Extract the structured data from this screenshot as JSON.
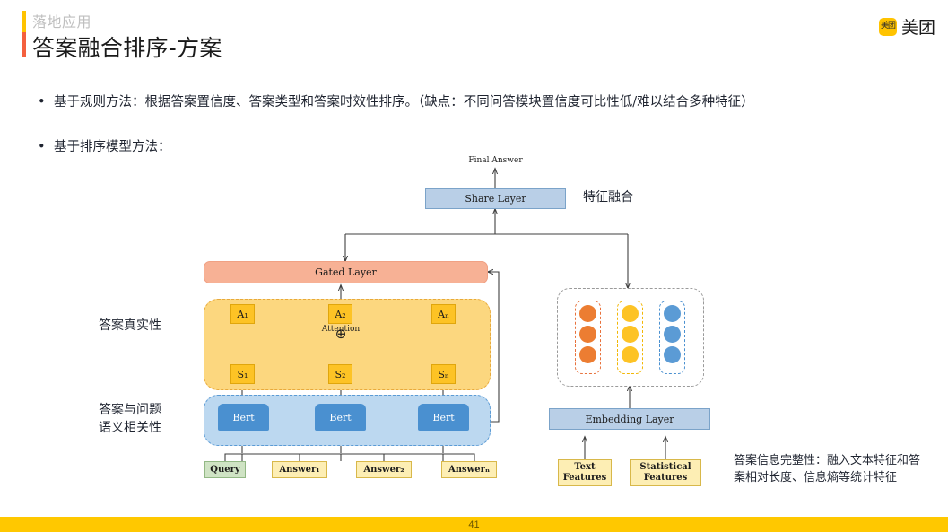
{
  "header": {
    "kicker": "落地应用",
    "title": "答案融合排序-方案",
    "accent_top": "#ffc300",
    "accent_bottom": "#f4603e"
  },
  "logo": {
    "mark_text": "美团",
    "text": "美团",
    "color": "#ffc300"
  },
  "bullets": [
    {
      "marker": "•",
      "text": "基于规则方法：根据答案置信度、答案类型和答案时效性排序。（缺点：不同问答模块置信度可比性低/难以结合多种特征）"
    },
    {
      "marker": "•",
      "text": "基于排序模型方法："
    }
  ],
  "diagram": {
    "final_answer": "Final Answer",
    "share_layer": "Share Layer",
    "fusion_note": "特征融合",
    "gated_layer": "Gated Layer",
    "attention_label": "Attention",
    "plus_symbol": "⊕",
    "attention_nodes": [
      "A₁",
      "A₂",
      "Aₙ"
    ],
    "score_nodes": [
      "S₁",
      "S₂",
      "Sₙ"
    ],
    "bert_nodes": [
      "Bert",
      "Bert",
      "Bert"
    ],
    "inputs": [
      {
        "label": "Query",
        "type": "query"
      },
      {
        "label": "Answer₁",
        "type": "answer"
      },
      {
        "label": "Answer₂",
        "type": "answer"
      },
      {
        "label": "Answerₙ",
        "type": "answer"
      }
    ],
    "embedding_layer": "Embedding Layer",
    "feature_inputs": [
      "Text\nFeatures",
      "Statistical\nFeatures"
    ],
    "feature_inputs_lines": [
      [
        "Text",
        "Features"
      ],
      [
        "Statistical",
        "Features"
      ]
    ],
    "left_notes": [
      {
        "lines": [
          "答案真实性"
        ]
      },
      {
        "lines": [
          "答案与问题",
          "语义相关性"
        ]
      }
    ],
    "right_note": "答案信息完整性：融入文本特征和答案相对长度、信息熵等统计特征",
    "feature_groups": [
      {
        "color": "#ec7d32",
        "name": "orange",
        "count": 3
      },
      {
        "color": "#fdc325",
        "name": "yellow",
        "count": 3
      },
      {
        "color": "#5b9bd5",
        "name": "blue",
        "count": 3
      }
    ]
  },
  "footer": {
    "page_number": "41",
    "color": "#ffc800"
  }
}
